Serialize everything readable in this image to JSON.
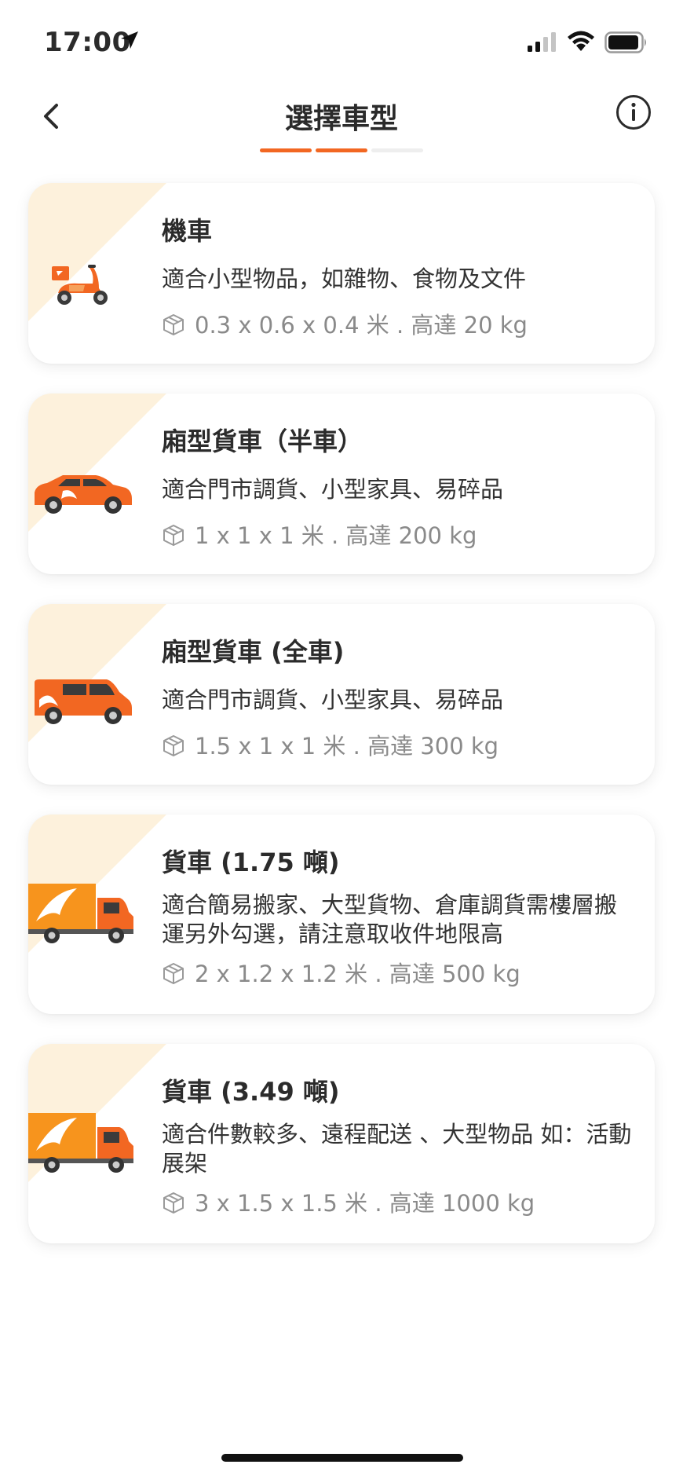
{
  "status_bar": {
    "time": "17:00"
  },
  "header": {
    "title": "選擇車型",
    "step_current": 2,
    "step_total": 3
  },
  "colors": {
    "accent": "#f26722",
    "corner": "#fdf1dc",
    "track": "#eeeeee"
  },
  "vehicles": [
    {
      "title": "機車",
      "description": "適合小型物品，如雜物、食物及文件",
      "spec": "0.3 x 0.6 x 0.4 米 . 高達 20 kg",
      "icon": "scooter-icon"
    },
    {
      "title": "廂型貨車（半車）",
      "description": "適合門市調貨、小型家具、易碎品",
      "spec": "1 x 1 x 1 米 . 高達 200 kg",
      "icon": "suv-icon"
    },
    {
      "title": "廂型貨車 (全車)",
      "description": "適合門市調貨、小型家具、易碎品",
      "spec": "1.5 x 1 x 1 米 . 高達 300 kg",
      "icon": "van-icon"
    },
    {
      "title": "貨車 (1.75 噸)",
      "description": "適合簡易搬家、大型貨物、倉庫調貨需樓層搬運另外勾選，請注意取收件地限高",
      "spec": "2 x 1.2 x 1.2 米 . 高達 500 kg",
      "icon": "truck-icon"
    },
    {
      "title": "貨車 (3.49 噸)",
      "description": "適合件數較多、遠程配送 、大型物品 如：活動展架",
      "spec": "3 x 1.5 x 1.5 米 . 高達 1000 kg",
      "icon": "large-truck-icon"
    }
  ]
}
